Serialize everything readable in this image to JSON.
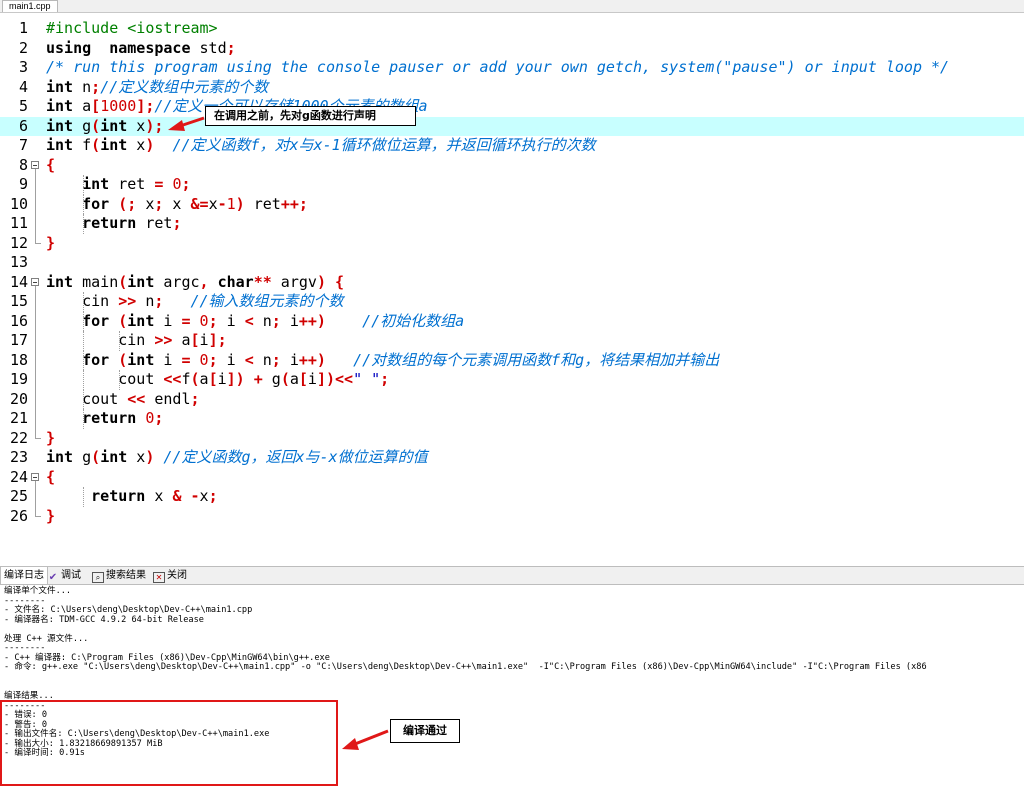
{
  "editor": {
    "file_tab": "main1.cpp",
    "lines": [
      {
        "n": "1",
        "t": [
          [
            "pp",
            "#include <iostream>"
          ]
        ]
      },
      {
        "n": "2",
        "t": [
          [
            "kw",
            "using"
          ],
          [
            "",
            "  "
          ],
          [
            "kw",
            "namespace"
          ],
          [
            "",
            " std"
          ],
          [
            "op",
            ";"
          ]
        ]
      },
      {
        "n": "3",
        "t": [
          [
            "cm",
            "/* run this program using the console pauser or add your own getch, system(\"pause\") or input loop */"
          ]
        ]
      },
      {
        "n": "4",
        "t": [
          [
            "kw",
            "int"
          ],
          [
            "",
            " n"
          ],
          [
            "op",
            ";"
          ],
          [
            "cm",
            "//定义数组中元素的个数"
          ]
        ]
      },
      {
        "n": "5",
        "t": [
          [
            "kw",
            "int"
          ],
          [
            "",
            " a"
          ],
          [
            "op",
            "["
          ],
          [
            "nm",
            "1000"
          ],
          [
            "op",
            "];"
          ],
          [
            "cm",
            "//定义一个可以存储1000个元素的数组a"
          ]
        ]
      },
      {
        "n": "6",
        "t": [
          [
            "kw",
            "int"
          ],
          [
            "",
            " g"
          ],
          [
            "op",
            "("
          ],
          [
            "kw",
            "int"
          ],
          [
            "",
            " x"
          ],
          [
            "op",
            ");"
          ]
        ]
      },
      {
        "n": "7",
        "t": [
          [
            "kw",
            "int"
          ],
          [
            "",
            " f"
          ],
          [
            "op",
            "("
          ],
          [
            "kw",
            "int"
          ],
          [
            "",
            " x"
          ],
          [
            "op",
            ")"
          ],
          [
            "",
            "  "
          ],
          [
            "cm",
            "//定义函数f，对x与x-1循环做位运算，并返回循环执行的次数"
          ]
        ]
      },
      {
        "n": "8",
        "t": [
          [
            "op",
            "{"
          ]
        ]
      },
      {
        "n": "9",
        "t": [
          [
            "",
            "    "
          ],
          [
            "kw",
            "int"
          ],
          [
            "",
            " ret "
          ],
          [
            "op",
            "="
          ],
          [
            "",
            " "
          ],
          [
            "nm",
            "0"
          ],
          [
            "op",
            ";"
          ]
        ]
      },
      {
        "n": "10",
        "t": [
          [
            "",
            "    "
          ],
          [
            "kw",
            "for"
          ],
          [
            "",
            " "
          ],
          [
            "op",
            "(;"
          ],
          [
            "",
            " x"
          ],
          [
            "op",
            ";"
          ],
          [
            "",
            " x "
          ],
          [
            "op",
            "&="
          ],
          [
            "",
            "x"
          ],
          [
            "op",
            "-"
          ],
          [
            "nm",
            "1"
          ],
          [
            "op",
            ")"
          ],
          [
            "",
            " ret"
          ],
          [
            "op",
            "++;"
          ]
        ]
      },
      {
        "n": "11",
        "t": [
          [
            "",
            "    "
          ],
          [
            "kw",
            "return"
          ],
          [
            "",
            " ret"
          ],
          [
            "op",
            ";"
          ]
        ]
      },
      {
        "n": "12",
        "t": [
          [
            "",
            ""
          ],
          [
            "op",
            "}"
          ]
        ]
      },
      {
        "n": "13",
        "t": []
      },
      {
        "n": "14",
        "t": [
          [
            "kw",
            "int"
          ],
          [
            "",
            " main"
          ],
          [
            "op",
            "("
          ],
          [
            "kw",
            "int"
          ],
          [
            "",
            " argc"
          ],
          [
            "op",
            ","
          ],
          [
            "",
            " "
          ],
          [
            "kw",
            "char"
          ],
          [
            "op",
            "**"
          ],
          [
            "",
            " argv"
          ],
          [
            "op",
            ")"
          ],
          [
            "",
            " "
          ],
          [
            "op",
            "{"
          ]
        ]
      },
      {
        "n": "15",
        "t": [
          [
            "",
            "    cin "
          ],
          [
            "op",
            ">>"
          ],
          [
            "",
            " n"
          ],
          [
            "op",
            ";"
          ],
          [
            "",
            "   "
          ],
          [
            "cm",
            "//输入数组元素的个数"
          ]
        ]
      },
      {
        "n": "16",
        "t": [
          [
            "",
            "    "
          ],
          [
            "kw",
            "for"
          ],
          [
            "",
            " "
          ],
          [
            "op",
            "("
          ],
          [
            "kw",
            "int"
          ],
          [
            "",
            " i "
          ],
          [
            "op",
            "="
          ],
          [
            "",
            " "
          ],
          [
            "nm",
            "0"
          ],
          [
            "op",
            ";"
          ],
          [
            "",
            " i "
          ],
          [
            "op",
            "<"
          ],
          [
            "",
            " n"
          ],
          [
            "op",
            ";"
          ],
          [
            "",
            " i"
          ],
          [
            "op",
            "++)"
          ],
          [
            "",
            "    "
          ],
          [
            "cm",
            "//初始化数组a"
          ]
        ]
      },
      {
        "n": "17",
        "t": [
          [
            "",
            "        cin "
          ],
          [
            "op",
            ">>"
          ],
          [
            "",
            " a"
          ],
          [
            "op",
            "["
          ],
          [
            "",
            "i"
          ],
          [
            "op",
            "];"
          ]
        ]
      },
      {
        "n": "18",
        "t": [
          [
            "",
            "    "
          ],
          [
            "kw",
            "for"
          ],
          [
            "",
            " "
          ],
          [
            "op",
            "("
          ],
          [
            "kw",
            "int"
          ],
          [
            "",
            " i "
          ],
          [
            "op",
            "="
          ],
          [
            "",
            " "
          ],
          [
            "nm",
            "0"
          ],
          [
            "op",
            ";"
          ],
          [
            "",
            " i "
          ],
          [
            "op",
            "<"
          ],
          [
            "",
            " n"
          ],
          [
            "op",
            ";"
          ],
          [
            "",
            " i"
          ],
          [
            "op",
            "++)"
          ],
          [
            "",
            "   "
          ],
          [
            "cm",
            "//对数组的每个元素调用函数f和g，将结果相加并输出"
          ]
        ]
      },
      {
        "n": "19",
        "t": [
          [
            "",
            "        cout "
          ],
          [
            "op",
            "<<"
          ],
          [
            "",
            "f"
          ],
          [
            "op",
            "("
          ],
          [
            "",
            "a"
          ],
          [
            "op",
            "["
          ],
          [
            "",
            "i"
          ],
          [
            "op",
            "])"
          ],
          [
            "",
            " "
          ],
          [
            "op",
            "+"
          ],
          [
            "",
            " g"
          ],
          [
            "op",
            "("
          ],
          [
            "",
            "a"
          ],
          [
            "op",
            "["
          ],
          [
            "",
            "i"
          ],
          [
            "op",
            "])<<"
          ],
          [
            "st",
            "\" \""
          ],
          [
            "op",
            ";"
          ]
        ]
      },
      {
        "n": "20",
        "t": [
          [
            "",
            "    cout "
          ],
          [
            "op",
            "<<"
          ],
          [
            "",
            " endl"
          ],
          [
            "op",
            ";"
          ]
        ]
      },
      {
        "n": "21",
        "t": [
          [
            "",
            "    "
          ],
          [
            "kw",
            "return"
          ],
          [
            "",
            " "
          ],
          [
            "nm",
            "0"
          ],
          [
            "op",
            ";"
          ]
        ]
      },
      {
        "n": "22",
        "t": [
          [
            "op",
            "}"
          ]
        ]
      },
      {
        "n": "23",
        "t": [
          [
            "kw",
            "int"
          ],
          [
            "",
            " g"
          ],
          [
            "op",
            "("
          ],
          [
            "kw",
            "int"
          ],
          [
            "",
            " x"
          ],
          [
            "op",
            ")"
          ],
          [
            "",
            " "
          ],
          [
            "cm",
            "//定义函数g，返回x与-x做位运算的值"
          ]
        ]
      },
      {
        "n": "24",
        "t": [
          [
            "op",
            "{"
          ]
        ]
      },
      {
        "n": "25",
        "t": [
          [
            "",
            "     "
          ],
          [
            "kw",
            "return"
          ],
          [
            "",
            " x "
          ],
          [
            "op",
            "&"
          ],
          [
            "",
            " "
          ],
          [
            "op",
            "-"
          ],
          [
            "",
            "x"
          ],
          [
            "op",
            ";"
          ]
        ]
      },
      {
        "n": "26",
        "t": [
          [
            "",
            ""
          ],
          [
            "op",
            "}"
          ]
        ]
      }
    ]
  },
  "callouts": {
    "declare_note": "在调用之前，先对g函数进行声明",
    "compile_ok_note": "编译通过"
  },
  "bottom_tabs": [
    "编译日志",
    "调试",
    "搜索结果",
    "关闭"
  ],
  "log_lines": [
    "编译单个文件...",
    "--------",
    "- 文件名: C:\\Users\\deng\\Desktop\\Dev-C++\\main1.cpp",
    "- 编译器名: TDM-GCC 4.9.2 64-bit Release",
    "",
    "处理 C++ 源文件...",
    "--------",
    "- C++ 编译器: C:\\Program Files (x86)\\Dev-Cpp\\MinGW64\\bin\\g++.exe",
    "- 命令: g++.exe \"C:\\Users\\deng\\Desktop\\Dev-C++\\main1.cpp\" -o \"C:\\Users\\deng\\Desktop\\Dev-C++\\main1.exe\"  -I\"C:\\Program Files (x86)\\Dev-Cpp\\MinGW64\\include\" -I\"C:\\Program Files (x86",
    "",
    "",
    "编译结果...",
    "--------",
    "- 错误: 0",
    "- 警告: 0",
    "- 输出文件名: C:\\Users\\deng\\Desktop\\Dev-C++\\main1.exe",
    "- 输出大小: 1.83218669891357 MiB",
    "- 编译时间: 0.91s"
  ]
}
